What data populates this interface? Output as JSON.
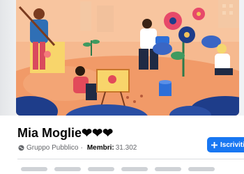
{
  "group": {
    "name": "Mia Moglie❤❤❤",
    "privacy": "Gruppo Pubblico",
    "separator": "·",
    "members_label": "Membri:",
    "members_count": "31.302"
  },
  "actions": {
    "join_label": "Iscriviti",
    "join_icon": "plus-icon"
  },
  "colors": {
    "accent": "#1877f2",
    "cover_bg": "#f5b68a"
  }
}
